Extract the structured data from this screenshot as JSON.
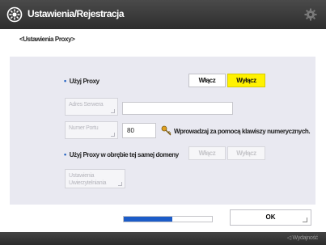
{
  "window": {
    "title": "Ustawienia/Rejestracja",
    "title_icon": "settings-registration-icon",
    "settings_icon": "gear-icon"
  },
  "breadcrumb": "<Ustawienia Proxy>",
  "proxy": {
    "label": "Użyj Proxy",
    "on_label": "Włącz",
    "off_label": "Wyłącz",
    "selected": "Wyłącz"
  },
  "server": {
    "button_label": "Adres Serwera",
    "value": ""
  },
  "port": {
    "button_label": "Numer Portu",
    "value": "80",
    "hint": "Wprowadzaj za pomocą klawiszy numerycznych.",
    "hint_icon": "key-icon"
  },
  "same_domain": {
    "label": "Użyj Proxy w obrębie tej samej domeny",
    "on_label": "Włącz",
    "off_label": "Wyłącz"
  },
  "auth": {
    "button_label_1": "Ustawienia",
    "button_label_2": "Uwierzytelniania"
  },
  "progress_fraction": 0.55,
  "ok_label": "OK",
  "footer": {
    "text": "◁ Wydajność"
  },
  "colors": {
    "accent": "#fff200",
    "progress": "#1c5cc8",
    "bullet": "#1f5fc0"
  }
}
